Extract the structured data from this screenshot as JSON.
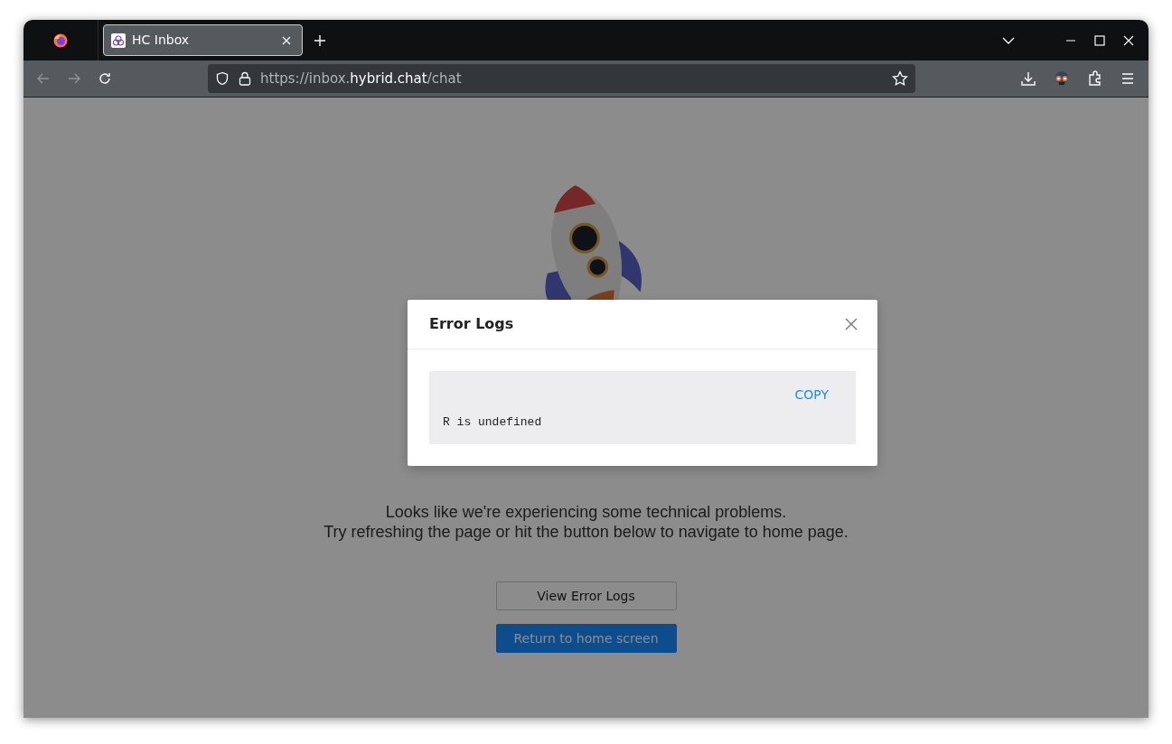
{
  "browser": {
    "tabs": [
      {
        "title": "HC Inbox",
        "selected": true
      }
    ],
    "url_parts": [
      {
        "text": "https://inbox.",
        "bright": false
      },
      {
        "text": "hybrid.chat",
        "bright": true
      },
      {
        "text": "/chat",
        "bright": false
      }
    ]
  },
  "page": {
    "message": [
      "Looks like we're experiencing some technical problems.",
      "Try refreshing the page or hit the button below to navigate to home page."
    ],
    "buttons": [
      {
        "label": "View Error Logs",
        "kind": "outline"
      },
      {
        "label": "Return to home screen",
        "kind": "primary"
      }
    ]
  },
  "modal": {
    "title": "Error Logs",
    "copy_label": "COPY",
    "log": "R is undefined"
  }
}
